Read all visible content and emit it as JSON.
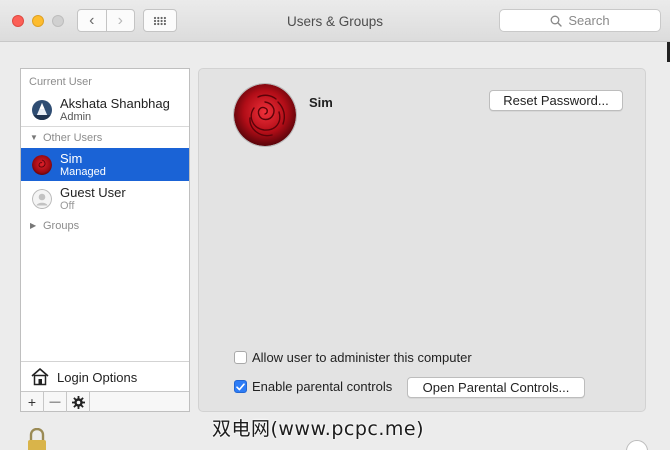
{
  "window": {
    "title": "Users & Groups",
    "search_placeholder": "Search",
    "nav_back": "‹",
    "nav_forward": "›"
  },
  "sidebar": {
    "current_user_label": "Current User",
    "current_user": {
      "name": "Akshata Shanbhag",
      "role": "Admin"
    },
    "other_users_label": "Other Users",
    "other_users": [
      {
        "name": "Sim",
        "role": "Managed",
        "selected": true
      },
      {
        "name": "Guest User",
        "role": "Off",
        "selected": false
      }
    ],
    "groups_label": "Groups",
    "login_options_label": "Login Options",
    "add_label": "+",
    "remove_label": "—"
  },
  "detail": {
    "user_name": "Sim",
    "reset_password_label": "Reset Password...",
    "allow_admin_label": "Allow user to administer this computer",
    "allow_admin_checked": false,
    "parental_controls_label": "Enable parental controls",
    "parental_controls_checked": true,
    "open_parental_label": "Open Parental Controls..."
  },
  "watermark": "双电网(www.pcpc.me)",
  "colors": {
    "selection": "#1a63d6",
    "checkbox_checked": "#2d7cf6",
    "close": "#fc5f57",
    "minimize": "#fdbc2e",
    "zoom": "#d0d0d0"
  },
  "icons": [
    "search-icon",
    "grid-icon",
    "rose-avatar",
    "admin-avatar-icon",
    "guest-avatar-icon",
    "house-icon",
    "gear-icon",
    "lock-icon"
  ]
}
